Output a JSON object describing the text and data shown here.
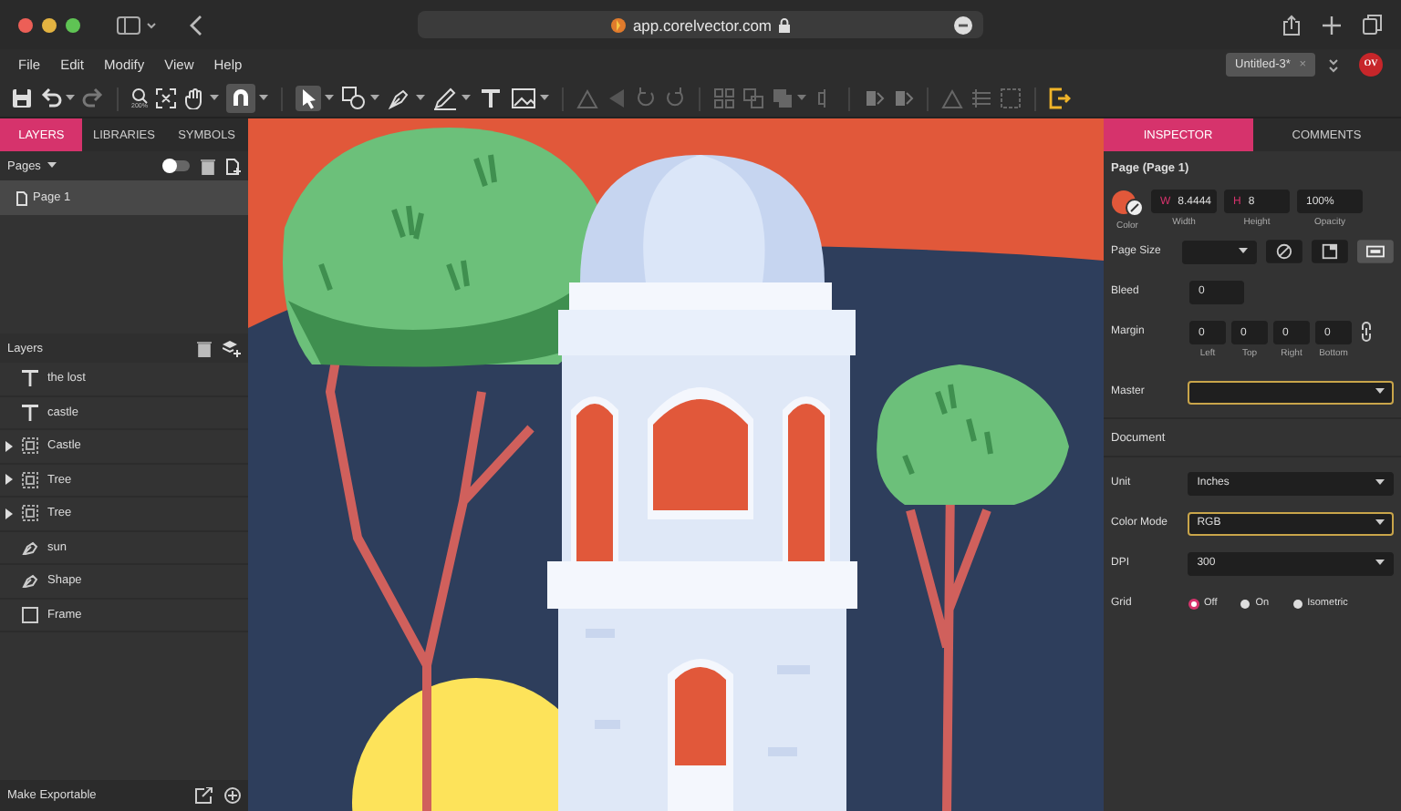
{
  "browser": {
    "url": "app.corelvector.com"
  },
  "menu": [
    "File",
    "Edit",
    "Modify",
    "View",
    "Help"
  ],
  "toolbar": {
    "zoom_label": "200%"
  },
  "document_tab": {
    "title": "Untitled-3*",
    "close": "×"
  },
  "avatar": {
    "initials": "OV"
  },
  "left_tabs": [
    {
      "label": "LAYERS",
      "selected": true
    },
    {
      "label": "LIBRARIES",
      "selected": false
    },
    {
      "label": "SYMBOLS",
      "selected": false
    }
  ],
  "pages": {
    "title": "Pages",
    "toggle_on": false,
    "items": [
      {
        "name": "Page 1",
        "selected": true
      }
    ]
  },
  "layers": {
    "title": "Layers",
    "items": [
      {
        "name": "the lost",
        "kind": "text"
      },
      {
        "name": "castle",
        "kind": "text"
      },
      {
        "name": "Castle",
        "kind": "group"
      },
      {
        "name": "Tree",
        "kind": "group"
      },
      {
        "name": "Tree",
        "kind": "group"
      },
      {
        "name": "sun",
        "kind": "path"
      },
      {
        "name": "Shape",
        "kind": "path"
      },
      {
        "name": "Frame",
        "kind": "frame"
      }
    ]
  },
  "footer": {
    "label": "Make Exportable"
  },
  "right_tabs": [
    {
      "label": "INSPECTOR",
      "selected": true
    },
    {
      "label": "COMMENTS",
      "selected": false
    }
  ],
  "inspector": {
    "title": "Page (Page 1)",
    "color_label": "Color",
    "dims": [
      {
        "prefix": "W",
        "value": "8.4444",
        "label": "Width"
      },
      {
        "prefix": "H",
        "value": "8",
        "label": "Height"
      },
      {
        "value": "100%",
        "label": "Opacity"
      }
    ],
    "page_size_label": "Page Size",
    "bleed_label": "Bleed",
    "bleed": "0",
    "margin_label": "Margin",
    "margins": [
      {
        "value": "0",
        "label": "Left"
      },
      {
        "value": "0",
        "label": "Top"
      },
      {
        "value": "0",
        "label": "Right"
      },
      {
        "value": "0",
        "label": "Bottom"
      }
    ],
    "master": {
      "label": "Master",
      "highlighted": true
    },
    "section": "Document",
    "selects": [
      {
        "label": "Unit",
        "value": "Inches",
        "highlighted": false
      },
      {
        "label": "Color Mode",
        "value": "RGB",
        "highlighted": true
      },
      {
        "label": "DPI",
        "value": "300",
        "highlighted": false
      }
    ],
    "grid_label": "Grid",
    "grid": [
      {
        "label": "Off",
        "selected": true
      },
      {
        "label": "On",
        "selected": false
      },
      {
        "label": "Isometric",
        "selected": false
      }
    ]
  }
}
